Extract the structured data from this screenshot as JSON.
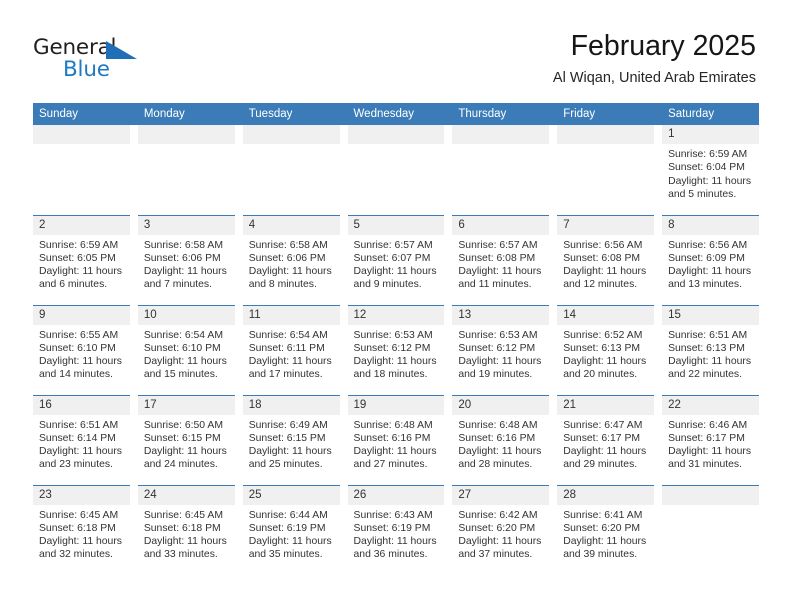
{
  "brand": {
    "name_top": "General",
    "name_bottom": "Blue",
    "color_dark": "#231f20",
    "color_blue": "#1f7ac4",
    "triangle_icon": "blue-triangle-icon"
  },
  "header": {
    "month_title": "February 2025",
    "location": "Al Wiqan, United Arab Emirates",
    "accent_color": "#3b7cb8",
    "daynum_band_color": "#f0f0f0"
  },
  "calendar": {
    "weekday_headers": [
      "Sunday",
      "Monday",
      "Tuesday",
      "Wednesday",
      "Thursday",
      "Friday",
      "Saturday"
    ],
    "labels": {
      "sunrise": "Sunrise:",
      "sunset": "Sunset:",
      "daylight": "Daylight:"
    },
    "weeks": [
      [
        {
          "day": "",
          "sunrise": "",
          "sunset": "",
          "daylight": "",
          "empty": true
        },
        {
          "day": "",
          "sunrise": "",
          "sunset": "",
          "daylight": "",
          "empty": true
        },
        {
          "day": "",
          "sunrise": "",
          "sunset": "",
          "daylight": "",
          "empty": true
        },
        {
          "day": "",
          "sunrise": "",
          "sunset": "",
          "daylight": "",
          "empty": true
        },
        {
          "day": "",
          "sunrise": "",
          "sunset": "",
          "daylight": "",
          "empty": true
        },
        {
          "day": "",
          "sunrise": "",
          "sunset": "",
          "daylight": "",
          "empty": true
        },
        {
          "day": "1",
          "sunrise": "Sunrise: 6:59 AM",
          "sunset": "Sunset: 6:04 PM",
          "daylight": "Daylight: 11 hours and 5 minutes.",
          "empty": false
        }
      ],
      [
        {
          "day": "2",
          "sunrise": "Sunrise: 6:59 AM",
          "sunset": "Sunset: 6:05 PM",
          "daylight": "Daylight: 11 hours and 6 minutes.",
          "empty": false
        },
        {
          "day": "3",
          "sunrise": "Sunrise: 6:58 AM",
          "sunset": "Sunset: 6:06 PM",
          "daylight": "Daylight: 11 hours and 7 minutes.",
          "empty": false
        },
        {
          "day": "4",
          "sunrise": "Sunrise: 6:58 AM",
          "sunset": "Sunset: 6:06 PM",
          "daylight": "Daylight: 11 hours and 8 minutes.",
          "empty": false
        },
        {
          "day": "5",
          "sunrise": "Sunrise: 6:57 AM",
          "sunset": "Sunset: 6:07 PM",
          "daylight": "Daylight: 11 hours and 9 minutes.",
          "empty": false
        },
        {
          "day": "6",
          "sunrise": "Sunrise: 6:57 AM",
          "sunset": "Sunset: 6:08 PM",
          "daylight": "Daylight: 11 hours and 11 minutes.",
          "empty": false
        },
        {
          "day": "7",
          "sunrise": "Sunrise: 6:56 AM",
          "sunset": "Sunset: 6:08 PM",
          "daylight": "Daylight: 11 hours and 12 minutes.",
          "empty": false
        },
        {
          "day": "8",
          "sunrise": "Sunrise: 6:56 AM",
          "sunset": "Sunset: 6:09 PM",
          "daylight": "Daylight: 11 hours and 13 minutes.",
          "empty": false
        }
      ],
      [
        {
          "day": "9",
          "sunrise": "Sunrise: 6:55 AM",
          "sunset": "Sunset: 6:10 PM",
          "daylight": "Daylight: 11 hours and 14 minutes.",
          "empty": false
        },
        {
          "day": "10",
          "sunrise": "Sunrise: 6:54 AM",
          "sunset": "Sunset: 6:10 PM",
          "daylight": "Daylight: 11 hours and 15 minutes.",
          "empty": false
        },
        {
          "day": "11",
          "sunrise": "Sunrise: 6:54 AM",
          "sunset": "Sunset: 6:11 PM",
          "daylight": "Daylight: 11 hours and 17 minutes.",
          "empty": false
        },
        {
          "day": "12",
          "sunrise": "Sunrise: 6:53 AM",
          "sunset": "Sunset: 6:12 PM",
          "daylight": "Daylight: 11 hours and 18 minutes.",
          "empty": false
        },
        {
          "day": "13",
          "sunrise": "Sunrise: 6:53 AM",
          "sunset": "Sunset: 6:12 PM",
          "daylight": "Daylight: 11 hours and 19 minutes.",
          "empty": false
        },
        {
          "day": "14",
          "sunrise": "Sunrise: 6:52 AM",
          "sunset": "Sunset: 6:13 PM",
          "daylight": "Daylight: 11 hours and 20 minutes.",
          "empty": false
        },
        {
          "day": "15",
          "sunrise": "Sunrise: 6:51 AM",
          "sunset": "Sunset: 6:13 PM",
          "daylight": "Daylight: 11 hours and 22 minutes.",
          "empty": false
        }
      ],
      [
        {
          "day": "16",
          "sunrise": "Sunrise: 6:51 AM",
          "sunset": "Sunset: 6:14 PM",
          "daylight": "Daylight: 11 hours and 23 minutes.",
          "empty": false
        },
        {
          "day": "17",
          "sunrise": "Sunrise: 6:50 AM",
          "sunset": "Sunset: 6:15 PM",
          "daylight": "Daylight: 11 hours and 24 minutes.",
          "empty": false
        },
        {
          "day": "18",
          "sunrise": "Sunrise: 6:49 AM",
          "sunset": "Sunset: 6:15 PM",
          "daylight": "Daylight: 11 hours and 25 minutes.",
          "empty": false
        },
        {
          "day": "19",
          "sunrise": "Sunrise: 6:48 AM",
          "sunset": "Sunset: 6:16 PM",
          "daylight": "Daylight: 11 hours and 27 minutes.",
          "empty": false
        },
        {
          "day": "20",
          "sunrise": "Sunrise: 6:48 AM",
          "sunset": "Sunset: 6:16 PM",
          "daylight": "Daylight: 11 hours and 28 minutes.",
          "empty": false
        },
        {
          "day": "21",
          "sunrise": "Sunrise: 6:47 AM",
          "sunset": "Sunset: 6:17 PM",
          "daylight": "Daylight: 11 hours and 29 minutes.",
          "empty": false
        },
        {
          "day": "22",
          "sunrise": "Sunrise: 6:46 AM",
          "sunset": "Sunset: 6:17 PM",
          "daylight": "Daylight: 11 hours and 31 minutes.",
          "empty": false
        }
      ],
      [
        {
          "day": "23",
          "sunrise": "Sunrise: 6:45 AM",
          "sunset": "Sunset: 6:18 PM",
          "daylight": "Daylight: 11 hours and 32 minutes.",
          "empty": false
        },
        {
          "day": "24",
          "sunrise": "Sunrise: 6:45 AM",
          "sunset": "Sunset: 6:18 PM",
          "daylight": "Daylight: 11 hours and 33 minutes.",
          "empty": false
        },
        {
          "day": "25",
          "sunrise": "Sunrise: 6:44 AM",
          "sunset": "Sunset: 6:19 PM",
          "daylight": "Daylight: 11 hours and 35 minutes.",
          "empty": false
        },
        {
          "day": "26",
          "sunrise": "Sunrise: 6:43 AM",
          "sunset": "Sunset: 6:19 PM",
          "daylight": "Daylight: 11 hours and 36 minutes.",
          "empty": false
        },
        {
          "day": "27",
          "sunrise": "Sunrise: 6:42 AM",
          "sunset": "Sunset: 6:20 PM",
          "daylight": "Daylight: 11 hours and 37 minutes.",
          "empty": false
        },
        {
          "day": "28",
          "sunrise": "Sunrise: 6:41 AM",
          "sunset": "Sunset: 6:20 PM",
          "daylight": "Daylight: 11 hours and 39 minutes.",
          "empty": false
        },
        {
          "day": "",
          "sunrise": "",
          "sunset": "",
          "daylight": "",
          "empty": true
        }
      ]
    ]
  }
}
